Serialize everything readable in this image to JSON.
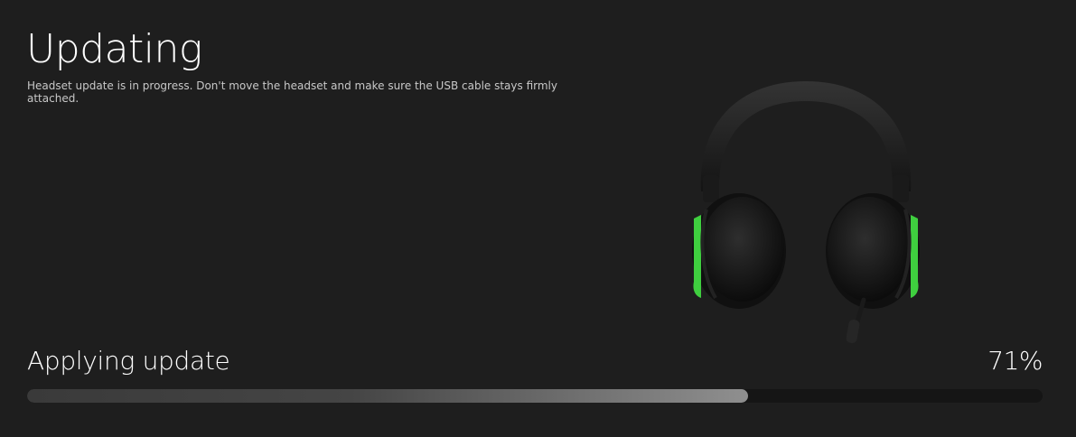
{
  "header": {
    "title": "Updating",
    "description": "Headset update is in progress. Don't move the headset and make sure the USB cable stays firmly attached."
  },
  "progress": {
    "status_label": "Applying update",
    "percent_label": "71%",
    "value": 0.71
  },
  "colors": {
    "background": "#1e1e1e",
    "accent_green": "#3fcf3f"
  },
  "image": {
    "icon": "wireless-headset"
  }
}
